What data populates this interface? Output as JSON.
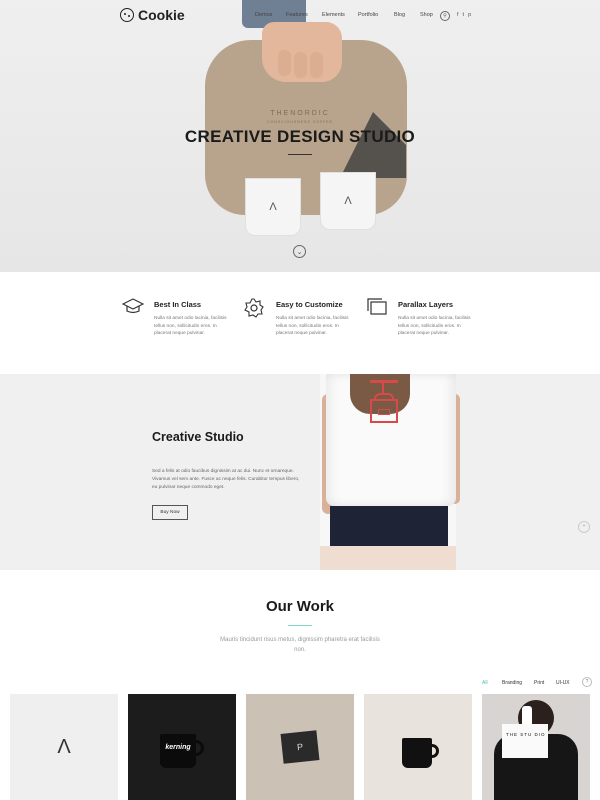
{
  "nav": {
    "logo": "Cookie",
    "menu": [
      "Demos",
      "Features",
      "Elements",
      "Portfolio",
      "Blog",
      "Shop"
    ],
    "social": [
      "f",
      "t",
      "p"
    ]
  },
  "hero": {
    "title": "CREATIVE DESIGN STUDIO",
    "product_brand": "THENORDIC",
    "product_tagline": "CONSCIOUSNESS COFFEE"
  },
  "features": [
    {
      "icon": "mortarboard-icon",
      "title": "Best In Class",
      "text": "Nulla sit amet odio lacinia, facilisis tellus non, sollicitudin eros. In placerat neque pulvinar."
    },
    {
      "icon": "gear-icon",
      "title": "Easy to Customize",
      "text": "Nulla sit amet odio lacinia, facilisis tellus non, sollicitudin eros. In placerat neque pulvinar."
    },
    {
      "icon": "layers-icon",
      "title": "Parallax Layers",
      "text": "Nulla sit amet odio lacinia, facilisis tellus non, sollicitudin eros. In placerat neque pulvinar."
    }
  ],
  "studio": {
    "title": "Creative Studio",
    "text": "Sed a felis at odio faucibus dignissim at ac dui. Nunc et ornareque. Vivamus vel sem ante. Fusce ac neque felis. Curabitur tempus libero, eu pulvinar neque commodo eget.",
    "button": "Buy Now"
  },
  "work": {
    "title": "Our Work",
    "subtitle": "Mauris tincidunt risus metus, dignissim pharetra erat facilisis non.",
    "filters": [
      "All",
      "Branding",
      "Print",
      "UI-UX"
    ],
    "mug_label": "kerning",
    "box_text": "THE STU DIO"
  },
  "colors": {
    "accent": "#4cbfae",
    "grinder": "#d84a4a",
    "dark": "#1a1a1a"
  }
}
